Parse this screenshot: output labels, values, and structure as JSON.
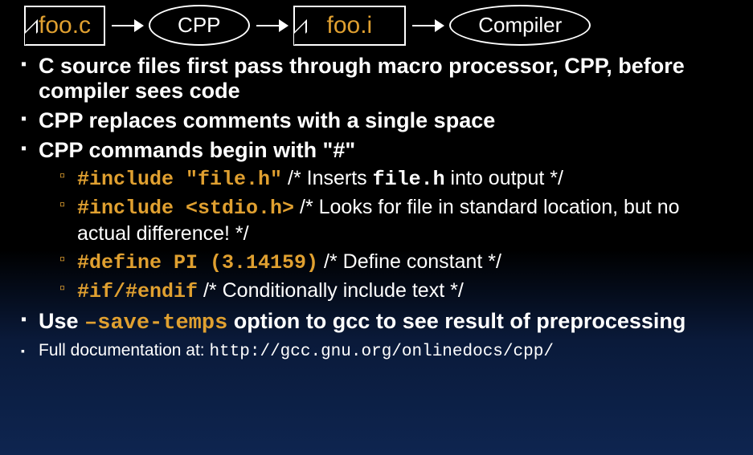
{
  "diagram": {
    "file1": "foo.c",
    "step1": "CPP",
    "file2": "foo.i",
    "step2": "Compiler"
  },
  "bullets": {
    "b1": "C source files first pass through macro processor, CPP, before compiler sees code",
    "b2": "CPP replaces comments with a single space",
    "b3": "CPP commands begin with \"#\"",
    "sub1_code": "#include \"file.h\"",
    "sub1_c1": "/* Inserts ",
    "sub1_file": "file.h",
    "sub1_c2": " into output */",
    "sub2_code": "#include <stdio.h>",
    "sub2_comment": "/* Looks for file in standard location, but no actual difference! */",
    "sub3_code": "#define PI (3.14159)",
    "sub3_comment": "/* Define constant */",
    "sub4_code": "#if/#endif",
    "sub4_comment": "/* Conditionally include text */",
    "b4a": "Use ",
    "b4_code": "–save-temps",
    "b4b": " option to gcc to see result of preprocessing",
    "b5a": "Full documentation at: ",
    "b5_url": "http://gcc.gnu.org/onlinedocs/cpp/"
  }
}
